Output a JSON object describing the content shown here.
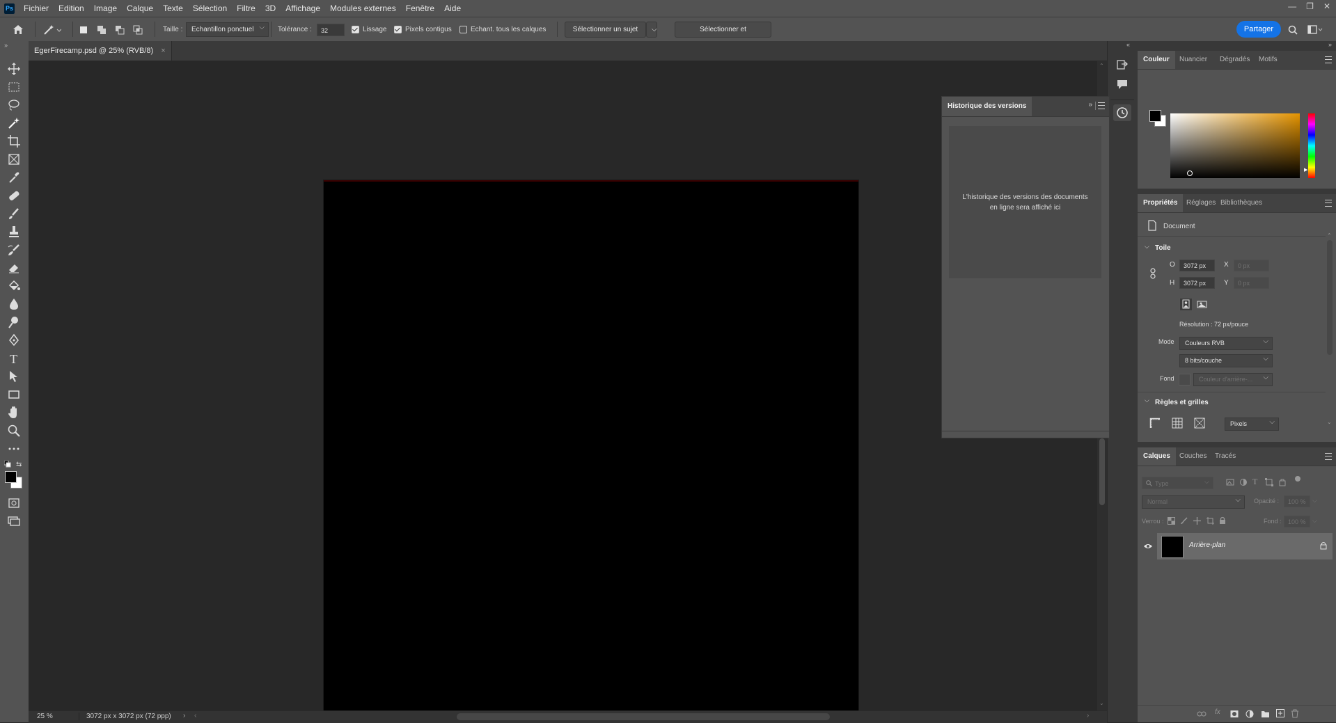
{
  "menu": {
    "logo": "Ps",
    "items": [
      "Fichier",
      "Edition",
      "Image",
      "Calque",
      "Texte",
      "Sélection",
      "Filtre",
      "3D",
      "Affichage",
      "Modules externes",
      "Fenêtre",
      "Aide"
    ]
  },
  "options": {
    "size_label": "Taille :",
    "size_value": "Echantillon ponctuel",
    "tolerance_label": "Tolérance :",
    "tolerance_value": "32",
    "antialias_label": "Lissage",
    "contiguous_label": "Pixels contigus",
    "sample_all_label": "Echant. tous les calques",
    "select_subject": "Sélectionner un sujet",
    "select_mask": "Sélectionner et masquer...",
    "share": "Partager"
  },
  "document": {
    "tab_title": "EgerFirecamp.psd @ 25% (RVB/8)",
    "zoom": "25 %",
    "dimensions": "3072 px x 3072 px (72 ppp)"
  },
  "version_panel": {
    "title": "Historique des versions",
    "message": "L'historique des versions des documents en ligne sera affiché ici"
  },
  "color_panel": {
    "tabs": [
      "Couleur",
      "Nuancier",
      "Dégradés",
      "Motifs"
    ],
    "fg_color": "#000000",
    "bg_color": "#ffffff"
  },
  "properties": {
    "tabs": [
      "Propriétés",
      "Réglages",
      "Bibliothèques"
    ],
    "doc_label": "Document",
    "canvas_section": "Toile",
    "w_label": "O",
    "w_value": "3072 px",
    "h_label": "H",
    "h_value": "3072 px",
    "x_label": "X",
    "x_value": "0 px",
    "y_label": "Y",
    "y_value": "0 px",
    "resolution": "Résolution : 72 px/pouce",
    "mode_label": "Mode",
    "mode_value": "Couleurs RVB",
    "depth_value": "8 bits/couche",
    "fill_label": "Fond",
    "fill_value": "Couleur d'arrière-...",
    "rulers_section": "Règles et grilles",
    "units_value": "Pixels"
  },
  "layers": {
    "tabs": [
      "Calques",
      "Couches",
      "Tracés"
    ],
    "filter_placeholder": "Type",
    "blend_mode": "Normal",
    "opacity_label": "Opacité :",
    "opacity_value": "100 %",
    "lock_label": "Verrou :",
    "fill_label": "Fond :",
    "fill_value": "100 %",
    "items": [
      {
        "name": "Arrière-plan"
      }
    ]
  }
}
